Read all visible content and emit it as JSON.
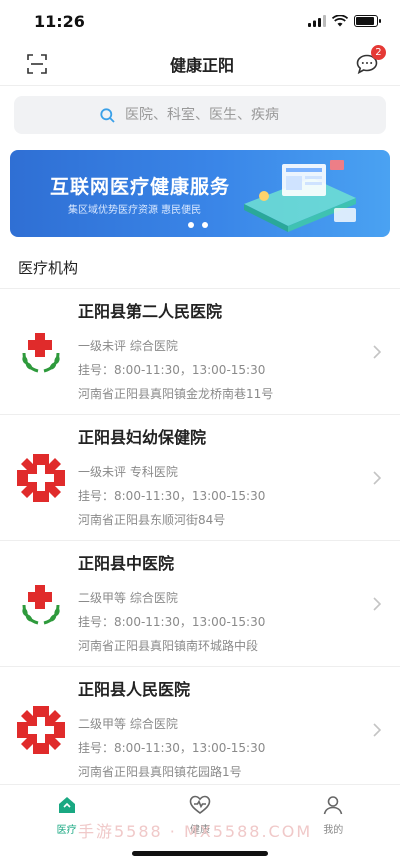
{
  "status": {
    "time": "11:26",
    "battery_level": 0.9
  },
  "nav": {
    "title": "健康正阳",
    "badge_count": "2",
    "left_icon": "scan-icon",
    "right_icon": "message-icon"
  },
  "search": {
    "placeholder": "医院、科室、医生、疾病"
  },
  "banner": {
    "title": "互联网医疗健康服务",
    "subtitle": "集区域优势医疗资源 惠民便民"
  },
  "section": {
    "title": "医疗机构"
  },
  "hospitals": [
    {
      "name": "正阳县第二人民医院",
      "level": "一级未评 综合医院",
      "hours": "挂号：8:00-11:30，13:00-15:30",
      "address": "河南省正阳县真阳镇金龙桥南巷11号",
      "logo": "green-cross-logo"
    },
    {
      "name": "正阳县妇幼保健院",
      "level": "一级未评 专科医院",
      "hours": "挂号：8:00-11:30，13:00-15:30",
      "address": "河南省正阳县东顺河街84号",
      "logo": "red-cross-logo"
    },
    {
      "name": "正阳县中医院",
      "level": "二级甲等 综合医院",
      "hours": "挂号：8:00-11:30，13:00-15:30",
      "address": "河南省正阳县真阳镇南环城路中段",
      "logo": "green-cross-logo"
    },
    {
      "name": "正阳县人民医院",
      "level": "二级甲等 综合医院",
      "hours": "挂号：8:00-11:30，13:00-15:30",
      "address": "河南省正阳县真阳镇花园路1号",
      "logo": "red-cross-logo"
    }
  ],
  "tabs": [
    {
      "label": "医疗",
      "icon": "home-icon",
      "active": true
    },
    {
      "label": "健康",
      "icon": "heart-icon",
      "active": false
    },
    {
      "label": "我的",
      "icon": "user-icon",
      "active": false
    }
  ],
  "watermark": "手游5588 · MX5588.COM",
  "colors": {
    "accent": "#19a882",
    "badge": "#e53935",
    "banner": "#3a86e8",
    "red_cross": "#e02b2b",
    "green_leaf": "#2e9a3c"
  }
}
